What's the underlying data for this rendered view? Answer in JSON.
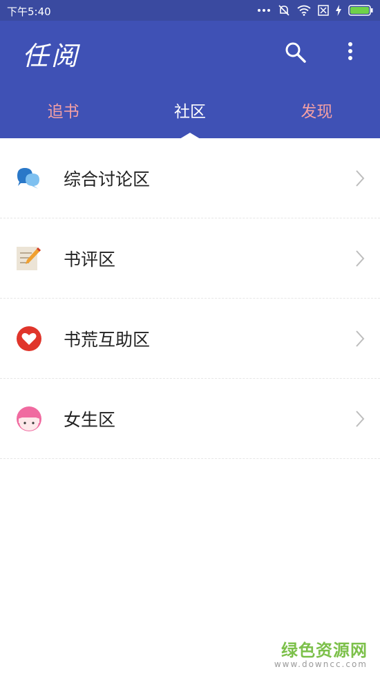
{
  "status_bar": {
    "time": "下午5:40",
    "icons": [
      "more-dots-icon",
      "mute-icon",
      "wifi-icon",
      "sim-icon",
      "charging-icon",
      "battery-icon"
    ]
  },
  "app_bar": {
    "title": "任阅",
    "actions": [
      "search-icon",
      "more-vert-icon"
    ]
  },
  "tabs": [
    {
      "label": "追书",
      "active": false
    },
    {
      "label": "社区",
      "active": true
    },
    {
      "label": "发现",
      "active": false
    }
  ],
  "community_list": [
    {
      "label": "综合讨论区",
      "icon": "chat-bubbles-icon"
    },
    {
      "label": "书评区",
      "icon": "notepad-pencil-icon"
    },
    {
      "label": "书荒互助区",
      "icon": "heart-icon"
    },
    {
      "label": "女生区",
      "icon": "girl-face-icon"
    }
  ],
  "watermark": {
    "main": "绿色资源网",
    "sub": "www.downcc.com"
  },
  "colors": {
    "appbar": "#3f51b5",
    "statusbar": "#3a4aa0",
    "tab_inactive": "#f4a0a4",
    "tab_active": "#ffffff"
  }
}
